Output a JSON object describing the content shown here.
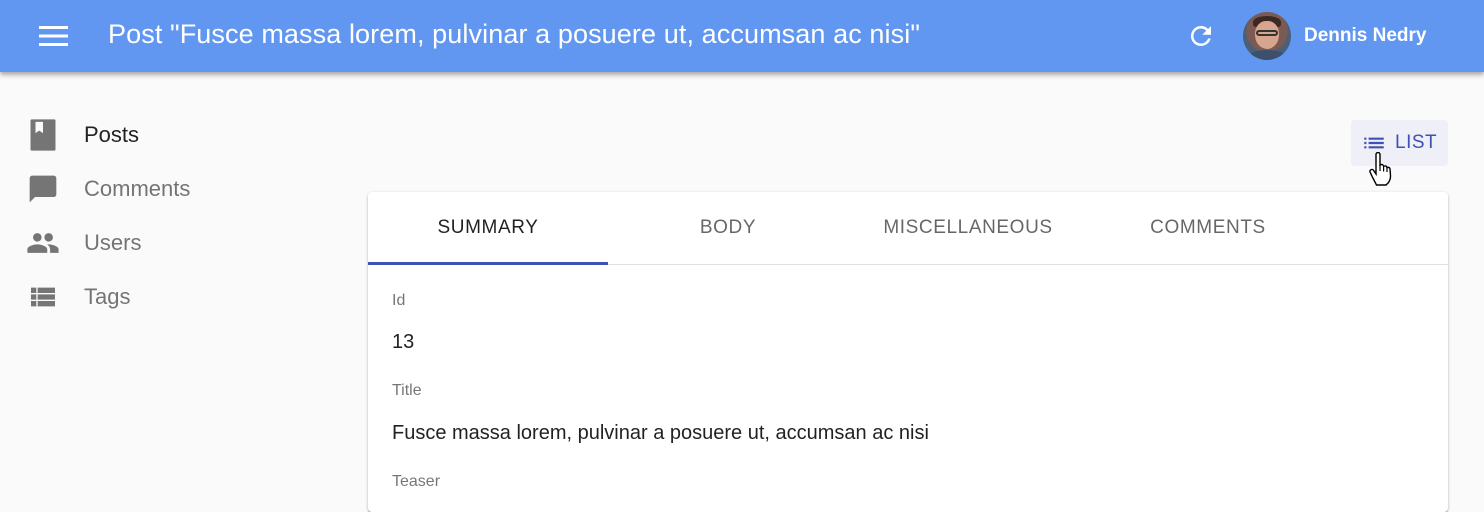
{
  "header": {
    "title": "Post \"Fusce massa lorem, pulvinar a posuere ut, accumsan ac nisi\"",
    "user_name": "Dennis Nedry",
    "icons": [
      "menu-icon",
      "refresh-icon"
    ],
    "background_color": "#6197f0"
  },
  "sidebar": {
    "items": [
      {
        "label": "Posts",
        "icon": "book-icon"
      },
      {
        "label": "Comments",
        "icon": "chat-bubble-icon"
      },
      {
        "label": "Users",
        "icon": "people-icon"
      },
      {
        "label": "Tags",
        "icon": "view-list-icon"
      }
    ]
  },
  "toolbar": {
    "list_label": "LIST",
    "list_icon": "list-icon"
  },
  "tabs": [
    {
      "label": "SUMMARY"
    },
    {
      "label": "BODY"
    },
    {
      "label": "MISCELLANEOUS"
    },
    {
      "label": "COMMENTS"
    }
  ],
  "summary": {
    "id_label": "Id",
    "id_value": "13",
    "title_label": "Title",
    "title_value": "Fusce massa lorem, pulvinar a posuere ut, accumsan ac nisi",
    "teaser_label": "Teaser"
  },
  "colors": {
    "accent": "#3f51b5"
  }
}
